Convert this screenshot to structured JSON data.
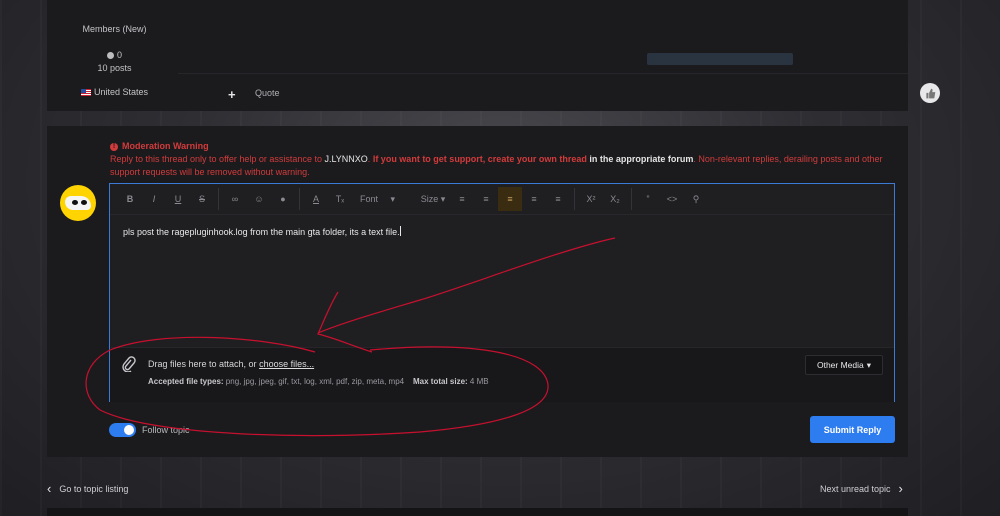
{
  "author": {
    "group": "Members (New)",
    "reputation": "0",
    "posts": "10 posts",
    "country": "United States"
  },
  "post_actions": {
    "quote_label": "Quote",
    "plus_icon": "plus-icon",
    "reaction_icon": "thumbs-up-icon"
  },
  "warning": {
    "title": "Moderation Warning",
    "p1": "Reply to this thread only to offer help or assistance to ",
    "user": "J.LYNNXO",
    "p2": ". ",
    "p3": "If you want to get support, create your own thread",
    "p4": " in the appropriate forum",
    "p5": ". Non-relevant replies, derailing posts and other support requests will be removed without warning."
  },
  "toolbar": {
    "font_label": "Font",
    "size_label": "Size",
    "icons": [
      "bold-icon",
      "italic-icon",
      "underline-icon",
      "strikethrough-icon",
      "link-icon",
      "emoji-icon",
      "spoiler-icon",
      "text-color-icon",
      "clear-format-icon",
      "bullet-list-icon",
      "numbered-list-icon",
      "align-left-icon",
      "align-center-icon",
      "align-right-icon",
      "superscript-icon",
      "subscript-icon",
      "quote-icon",
      "code-icon",
      "preview-icon"
    ]
  },
  "editor": {
    "text": "pls post the ragepluginhook.log from the main gta folder, its a text file."
  },
  "attach": {
    "drag_text": "Drag files here to attach, or ",
    "choose_link": "choose files...",
    "accepted_label": "Accepted file types:",
    "accepted_types": " png, jpg, jpeg, gif, txt, log, xml, pdf, zip, meta, mp4",
    "max_label": "Max total size:",
    "max_value": " 4 MB",
    "other_media": "Other Media"
  },
  "reply": {
    "follow_label": "Follow topic",
    "follow_on": true,
    "submit_label": "Submit Reply"
  },
  "nav": {
    "prev": "Go to topic listing",
    "next": "Next unread topic"
  },
  "colors": {
    "accent": "#2d7cf0",
    "warning": "#d23b3b",
    "annotation": "#c8102e"
  }
}
